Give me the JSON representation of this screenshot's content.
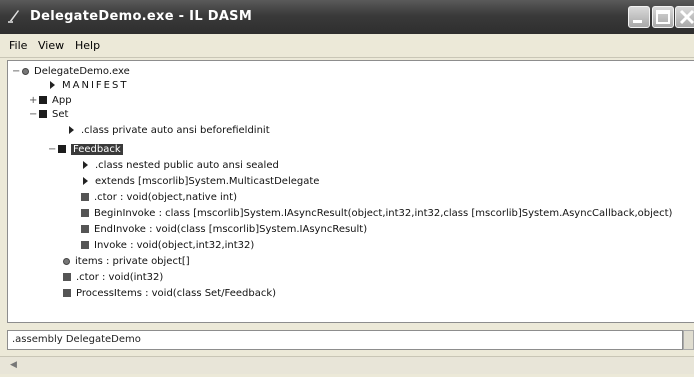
{
  "window": {
    "title": "DelegateDemo.exe - IL DASM"
  },
  "menu": {
    "items": [
      "File",
      "View",
      "Help"
    ]
  },
  "tree": {
    "root": "DelegateDemo.exe",
    "manifest": "MANIFEST",
    "app": "App",
    "set": "Set",
    "set_class": ".class private auto ansi beforefieldinit",
    "feedback": "Feedback",
    "fb_class": ".class nested public auto ansi sealed",
    "fb_extends": "extends [mscorlib]System.MulticastDelegate",
    "fb_ctor": ".ctor : void(object,native int)",
    "fb_begin": "BeginInvoke : class [mscorlib]System.IAsyncResult(object,int32,int32,class [mscorlib]System.AsyncCallback,object)",
    "fb_end": "EndInvoke : void(class [mscorlib]System.IAsyncResult)",
    "fb_invoke": "Invoke : void(object,int32,int32)",
    "items": "items : private object[]",
    "set_ctor": ".ctor : void(int32)",
    "process": "ProcessItems : void(class Set/Feedback)"
  },
  "status": {
    "text": ".assembly DelegateDemo"
  },
  "colors": {
    "titlebar": "#3a3a3a",
    "selection": "#3a3a3a"
  },
  "icons": {
    "title": "ildasm-app-icon",
    "node": "square-node-icon",
    "item": "triangle-item-icon",
    "field": "diamond-field-icon"
  }
}
